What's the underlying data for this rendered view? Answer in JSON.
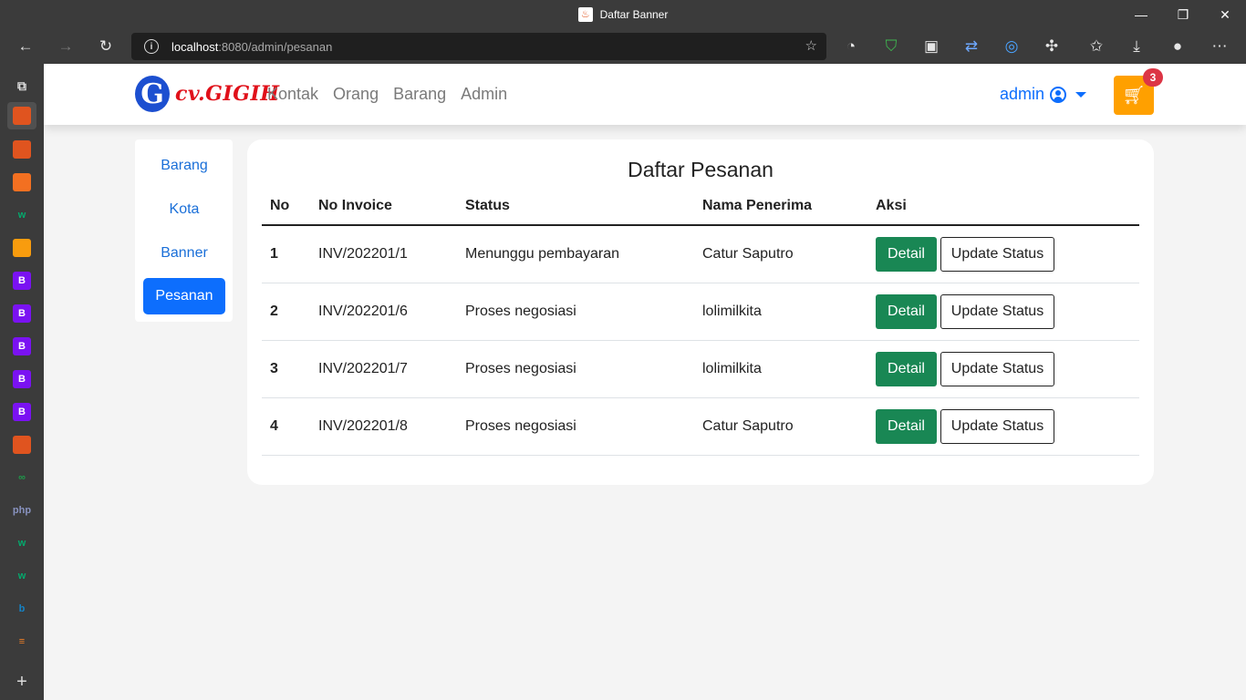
{
  "browser": {
    "tab_title": "Daftar Banner",
    "url_host": "localhost",
    "url_rest": ":8080/admin/pesanan"
  },
  "vertical_tabs": [
    {
      "icon": "codeigniter-icon",
      "label": "",
      "color": "#e0541f"
    },
    {
      "icon": "codeigniter-icon",
      "label": "",
      "color": "#e0541f"
    },
    {
      "icon": "xampp-icon",
      "label": "",
      "color": "#f37021"
    },
    {
      "icon": "w3schools-icon",
      "label": "w",
      "color": "#04aa6d"
    },
    {
      "icon": "phpmyadmin-icon",
      "label": "",
      "color": "#f89c0e"
    },
    {
      "icon": "bootstrap-icon",
      "label": "B",
      "color": "#7a12f2"
    },
    {
      "icon": "bootstrap-icon",
      "label": "B",
      "color": "#7a12f2"
    },
    {
      "icon": "bootstrap-icon",
      "label": "B",
      "color": "#7a12f2"
    },
    {
      "icon": "bootstrap-icon",
      "label": "B",
      "color": "#7a12f2"
    },
    {
      "icon": "bootstrap-icon",
      "label": "B",
      "color": "#7a12f2"
    },
    {
      "icon": "codeigniter-icon",
      "label": "",
      "color": "#e0541f"
    },
    {
      "icon": "infinity-icon",
      "label": "∞",
      "color": "#1e9b4a"
    },
    {
      "icon": "php-icon",
      "label": "php",
      "color": "#8892bf"
    },
    {
      "icon": "w3schools-icon",
      "label": "w",
      "color": "#04aa6d"
    },
    {
      "icon": "w3schools-icon",
      "label": "w",
      "color": "#04aa6d"
    },
    {
      "icon": "bing-icon",
      "label": "b",
      "color": "#1583c6"
    },
    {
      "icon": "stackoverflow-icon",
      "label": "≡",
      "color": "#f48024"
    }
  ],
  "navbar": {
    "logo_letter": "G",
    "logo_text": "cv.GIGIH",
    "links": [
      "Kontak",
      "Orang",
      "Barang",
      "Admin"
    ],
    "user_label": "admin",
    "cart_count": "3",
    "accent_color": "#0d6efd",
    "cart_color": "#ffa000"
  },
  "sidemenu": {
    "items": [
      "Barang",
      "Kota",
      "Banner",
      "Pesanan"
    ],
    "active": "Pesanan"
  },
  "main": {
    "title": "Daftar Pesanan",
    "columns": [
      "No",
      "No Invoice",
      "Status",
      "Nama Penerima",
      "Aksi"
    ],
    "rows": [
      {
        "no": "1",
        "invoice": "INV/202201/1",
        "status": "Menunggu pembayaran",
        "penerima": "Catur Saputro"
      },
      {
        "no": "2",
        "invoice": "INV/202201/6",
        "status": "Proses negosiasi",
        "penerima": "lolimilkita"
      },
      {
        "no": "3",
        "invoice": "INV/202201/7",
        "status": "Proses negosiasi",
        "penerima": "lolimilkita"
      },
      {
        "no": "4",
        "invoice": "INV/202201/8",
        "status": "Proses negosiasi",
        "penerima": "Catur Saputro"
      }
    ],
    "detail_label": "Detail",
    "update_label": "Update Status",
    "detail_color": "#198754"
  }
}
